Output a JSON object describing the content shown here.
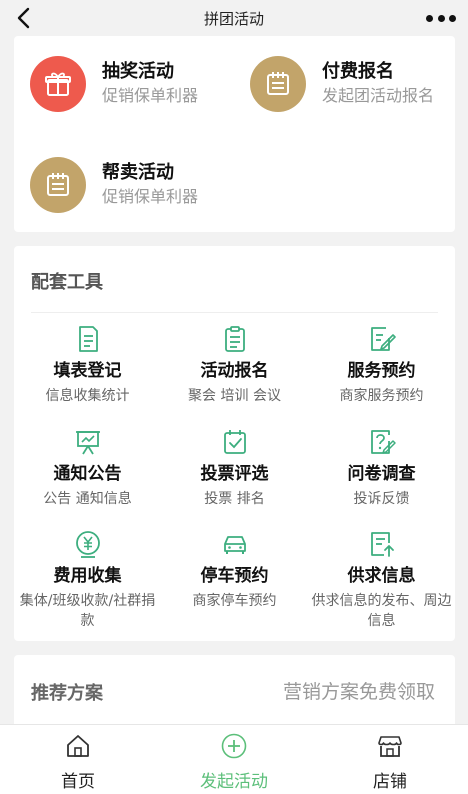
{
  "header": {
    "title": "拼团活动"
  },
  "activities": [
    {
      "title": "抽奖活动",
      "subtitle": "促销保单利器",
      "icon": "gift-icon",
      "color": "#ee5a4d"
    },
    {
      "title": "付费报名",
      "subtitle": "发起团活动报名",
      "icon": "notepad-icon",
      "color": "#c2a46a"
    },
    {
      "title": "帮卖活动",
      "subtitle": "促销保单利器",
      "icon": "notepad-icon",
      "color": "#c2a46a"
    }
  ],
  "tools": {
    "section_title": "配套工具",
    "items": [
      {
        "title": "填表登记",
        "subtitle": "信息收集统计",
        "icon": "form-icon"
      },
      {
        "title": "活动报名",
        "subtitle": "聚会 培训 会议",
        "icon": "clipboard-icon"
      },
      {
        "title": "服务预约",
        "subtitle": "商家服务预约",
        "icon": "edit-document-icon"
      },
      {
        "title": "通知公告",
        "subtitle": "公告 通知信息",
        "icon": "presentation-board-icon"
      },
      {
        "title": "投票评选",
        "subtitle": "投票 排名",
        "icon": "vote-check-icon"
      },
      {
        "title": "问卷调查",
        "subtitle": "投诉反馈",
        "icon": "question-document-icon"
      },
      {
        "title": "费用收集",
        "subtitle": "集体/班级收款/社群捐款",
        "icon": "yuan-coin-icon"
      },
      {
        "title": "停车预约",
        "subtitle": "商家停车预约",
        "icon": "car-icon"
      },
      {
        "title": "供求信息",
        "subtitle": "供求信息的发布、周边信息",
        "icon": "document-upload-icon"
      }
    ],
    "accent": "#3dae7f"
  },
  "recommend": {
    "title": "推荐方案",
    "right_text": "营销方案免费领取"
  },
  "tabbar": {
    "items": [
      {
        "label": "首页",
        "icon": "home-icon"
      },
      {
        "label": "发起活动",
        "icon": "plus-circle-icon"
      },
      {
        "label": "店铺",
        "icon": "store-icon"
      }
    ],
    "active_color": "#5cbf7a"
  }
}
